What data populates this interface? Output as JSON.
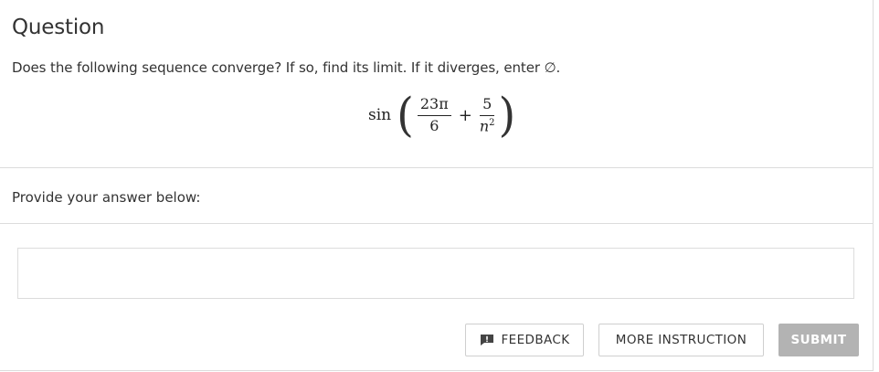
{
  "question": {
    "title": "Question",
    "prompt": "Does the following sequence converge? If so, find its limit. If it diverges, enter ∅.",
    "formula": {
      "function": "sin",
      "left_paren": "(",
      "term1_numerator": "23π",
      "term1_denominator": "6",
      "operator": "+",
      "term2_numerator": "5",
      "term2_denominator_base": "n",
      "term2_denominator_exponent": "2",
      "right_paren": ")"
    }
  },
  "answer": {
    "label": "Provide your answer below:",
    "value": "",
    "placeholder": ""
  },
  "buttons": {
    "feedback": "FEEDBACK",
    "more_instruction": "MORE INSTRUCTION",
    "submit": "SUBMIT"
  },
  "icons": {
    "feedback": "feedback-speech-bubble-icon"
  },
  "colors": {
    "submit_disabled_bg": "#b3b3b3",
    "border": "#dcdcdc",
    "text": "#333333"
  }
}
